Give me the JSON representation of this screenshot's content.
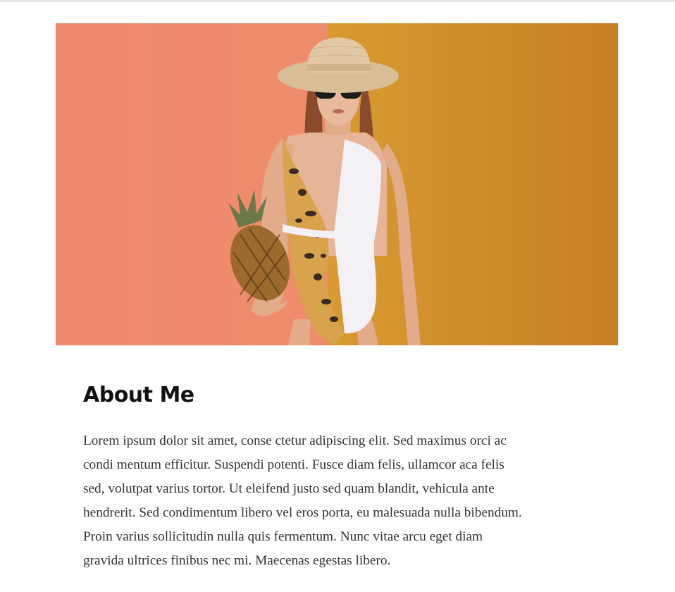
{
  "hero_image": {
    "icon": "photo-woman-hat-sunglasses-swimsuit-pineapple",
    "colors": {
      "left_background": "#f0896c",
      "right_background": "#d6922a",
      "swimsuit_white": "#f4f2f6",
      "leopard_print": "#d9a24d",
      "hat": "#dcc29b",
      "skin": "#e5b394",
      "pineapple": "#9b6a2c"
    }
  },
  "about": {
    "heading": "About Me",
    "paragraph": "Lorem ipsum dolor sit amet, conse ctetur adipiscing elit. Sed maximus orci ac\ncondi mentum efficitur. Suspendi potenti. Fusce diam felis, ullamcor aca felis\nsed, volutpat varius tortor. Ut eleifend justo sed quam blandit, vehicula ante\nhendrerit. Sed condimentum libero vel eros porta, eu malesuada nulla bibendum.\nProin varius sollicitudin nulla quis fermentum. Nunc vitae arcu eget diam\ngravida ultrices finibus nec mi. Maecenas egestas libero."
  }
}
